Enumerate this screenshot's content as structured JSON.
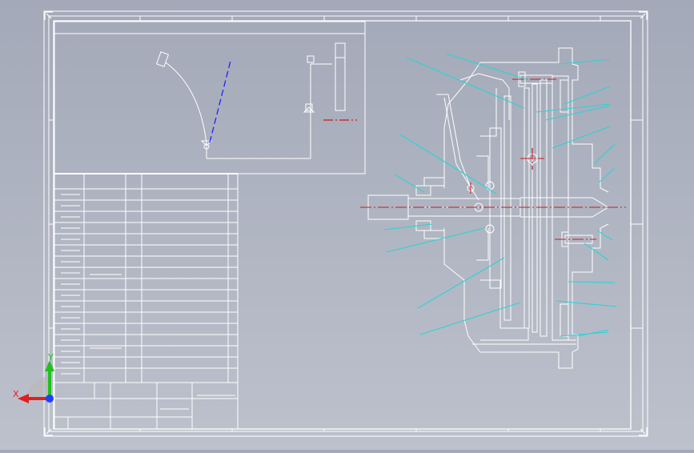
{
  "app": {
    "view": "drawing-sheet",
    "background_top": "#a3a9b8",
    "background_bottom": "#bdc1cc"
  },
  "colors": {
    "line_white": "#ffffff",
    "leader_cyan": "#2ad4d4",
    "centerline_red": "#d01818",
    "dimension_blue": "#2020ff",
    "axis_x": "#e02020",
    "axis_y": "#20c020",
    "axis_z": "#2040ff"
  },
  "triad": {
    "x_label": "X",
    "y_label": "Y"
  },
  "icons": {
    "triad": "coordinate-triad-icon",
    "corner": "sheet-corner-marker-icon"
  }
}
